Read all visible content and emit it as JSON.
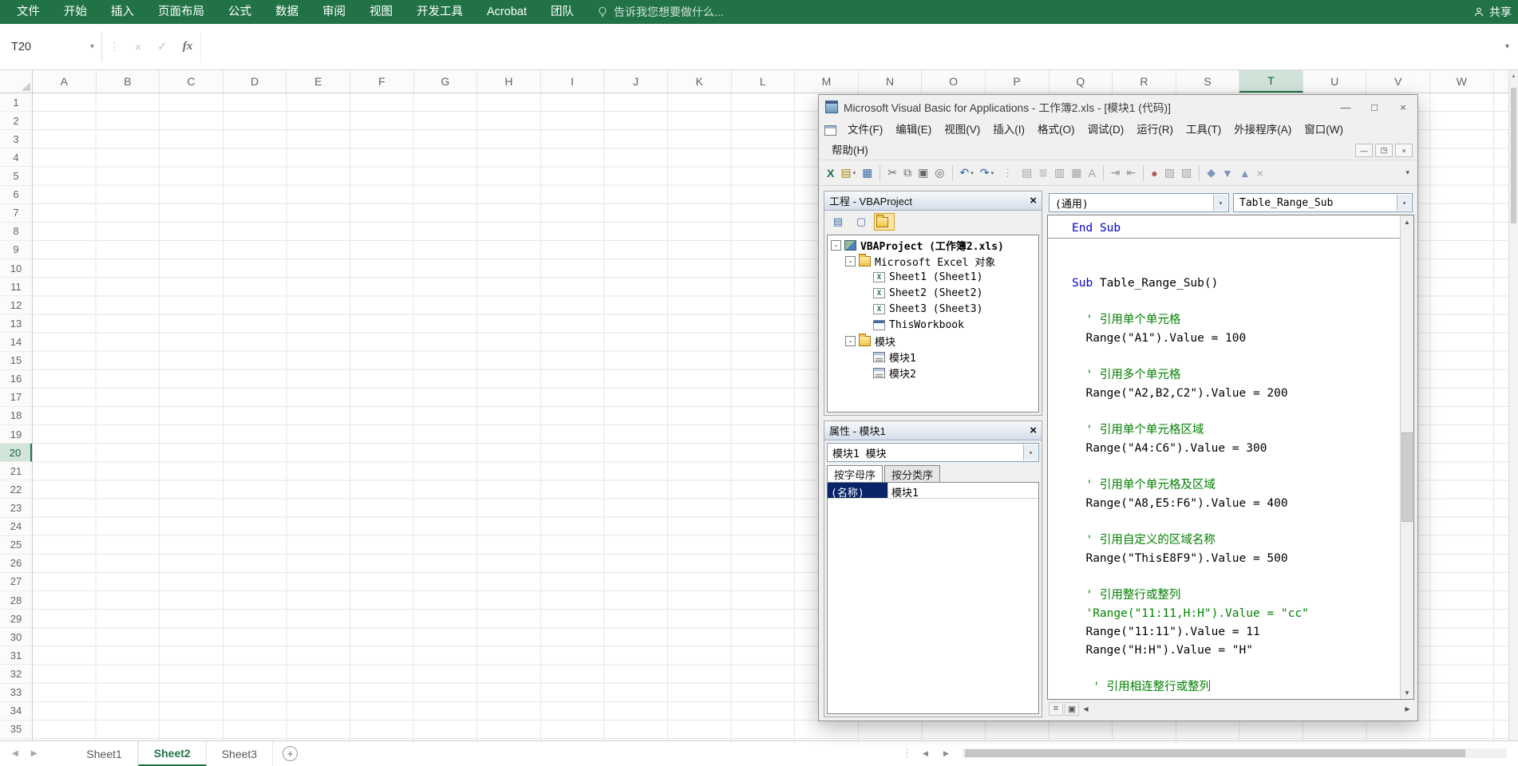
{
  "colors": {
    "excel_green": "#217346",
    "keyword_blue": "#0000d4",
    "comment_green": "#008000",
    "selection_blue": "#0a246a"
  },
  "icons": {
    "dropdown": "▾",
    "grip": "⋮",
    "cancel": "×",
    "confirm": "✓",
    "tri_up": "▲",
    "tri_down": "▼",
    "tri_left": "◀",
    "tri_right": "▶",
    "minimize": "—",
    "maximize": "□",
    "close": "×",
    "restore": "◳",
    "plus": "+",
    "collapse": "-",
    "chevron_down": "▾",
    "procedure_view": "≡",
    "module_view": "▣"
  },
  "excel": {
    "ribbon": {
      "tabs": [
        "文件",
        "开始",
        "插入",
        "页面布局",
        "公式",
        "数据",
        "审阅",
        "视图",
        "开发工具",
        "Acrobat",
        "团队"
      ],
      "tell_me": "告诉我您想要做什么...",
      "share": "共享"
    },
    "formula_bar": {
      "name_box": "T20",
      "fx": "fx",
      "value": ""
    },
    "columns": [
      "A",
      "B",
      "C",
      "D",
      "E",
      "F",
      "G",
      "H",
      "I",
      "J",
      "K",
      "L",
      "M",
      "N",
      "O",
      "P",
      "Q",
      "R",
      "S",
      "T",
      "U",
      "V",
      "W"
    ],
    "rows": [
      "1",
      "2",
      "3",
      "4",
      "5",
      "6",
      "7",
      "8",
      "9",
      "10",
      "11",
      "12",
      "13",
      "14",
      "15",
      "16",
      "17",
      "18",
      "19",
      "20",
      "21",
      "22",
      "23",
      "24",
      "25",
      "26",
      "27",
      "28",
      "29",
      "30",
      "31",
      "32",
      "33",
      "34",
      "35"
    ],
    "active_cell": {
      "column": "T",
      "row": "20"
    },
    "sheet_tabs": [
      "Sheet1",
      "Sheet2",
      "Sheet3"
    ],
    "active_sheet": "Sheet2"
  },
  "vba": {
    "title": "Microsoft Visual Basic for Applications - 工作簿2.xls - [模块1 (代码)]",
    "menus_row1": [
      "文件(F)",
      "编辑(E)",
      "视图(V)",
      "插入(I)",
      "格式(O)",
      "调试(D)",
      "运行(R)",
      "工具(T)",
      "外接程序(A)",
      "窗口(W)"
    ],
    "menus_row2": [
      "帮助(H)"
    ],
    "toolbar": [
      {
        "name": "view-excel-button",
        "glyph": "X",
        "color": "#1e7145",
        "bold": true
      },
      {
        "name": "insert-userform-button",
        "glyph": "▤",
        "color": "#a98500",
        "dropdown": true
      },
      {
        "name": "save-button",
        "glyph": "▦",
        "color": "#3a6ea5"
      },
      {
        "sep": true
      },
      {
        "name": "cut-button",
        "glyph": "✂",
        "color": "#666666"
      },
      {
        "name": "copy-button",
        "glyph": "⧉",
        "color": "#666666"
      },
      {
        "name": "paste-button",
        "glyph": "▣",
        "color": "#666666"
      },
      {
        "name": "find-button",
        "glyph": "◎",
        "color": "#666666"
      },
      {
        "sep": true
      },
      {
        "name": "undo-button",
        "glyph": "↶",
        "color": "#2f5f9e",
        "dropdown": true
      },
      {
        "name": "redo-button",
        "glyph": "↷",
        "color": "#2f5f9e",
        "dropdown": true
      },
      {
        "grip": true
      },
      {
        "name": "list-properties-button",
        "glyph": "▤",
        "color": "#a3a3a3",
        "disabled": true
      },
      {
        "name": "list-constants-button",
        "glyph": "≣",
        "color": "#a3a3a3",
        "disabled": true
      },
      {
        "name": "quick-info-button",
        "glyph": "▥",
        "color": "#a3a3a3",
        "disabled": true
      },
      {
        "name": "parameter-info-button",
        "glyph": "▦",
        "color": "#a3a3a3",
        "disabled": true
      },
      {
        "name": "complete-word-button",
        "glyph": "A",
        "color": "#a3a3a3",
        "disabled": true
      },
      {
        "sep": true
      },
      {
        "name": "indent-button",
        "glyph": "⇥",
        "color": "#8f8f8f",
        "disabled": true
      },
      {
        "name": "outdent-button",
        "glyph": "⇤",
        "color": "#8f8f8f",
        "disabled": true
      },
      {
        "sep": true
      },
      {
        "name": "toggle-breakpoint-button",
        "glyph": "●",
        "color": "#b05a5a",
        "disabled": true
      },
      {
        "name": "comment-block-button",
        "glyph": "▧",
        "color": "#a3a3a3",
        "disabled": true
      },
      {
        "name": "uncomment-block-button",
        "glyph": "▨",
        "color": "#a3a3a3",
        "disabled": true
      },
      {
        "sep": true
      },
      {
        "name": "toggle-bookmark-button",
        "glyph": "◆",
        "color": "#7e97b8",
        "disabled": true
      },
      {
        "name": "next-bookmark-button",
        "glyph": "▼",
        "color": "#7e97b8",
        "disabled": true
      },
      {
        "name": "previous-bookmark-button",
        "glyph": "▲",
        "color": "#7e97b8",
        "disabled": true
      },
      {
        "name": "clear-bookmarks-button",
        "glyph": "×",
        "color": "#a3a3a3",
        "disabled": true
      },
      {
        "overflow": true
      }
    ],
    "project": {
      "title": "工程 - VBAProject",
      "toolbar": [
        {
          "name": "view-code-button",
          "glyph": "▤",
          "color": "#3a6ea5"
        },
        {
          "name": "view-object-button",
          "glyph": "▢",
          "color": "#3a6ea5"
        },
        {
          "name": "toggle-folders-button",
          "glyph": "folder",
          "active": true
        }
      ],
      "tree": [
        {
          "label": "VBAProject (工作簿2.xls)",
          "level": 0,
          "icon": "project",
          "expander": true,
          "bold": true
        },
        {
          "label": "Microsoft Excel 对象",
          "level": 1,
          "icon": "folder",
          "expander": true
        },
        {
          "label": "Sheet1 (Sheet1)",
          "level": 2,
          "icon": "sheet"
        },
        {
          "label": "Sheet2 (Sheet2)",
          "level": 2,
          "icon": "sheet"
        },
        {
          "label": "Sheet3 (Sheet3)",
          "level": 2,
          "icon": "sheet"
        },
        {
          "label": "ThisWorkbook",
          "level": 2,
          "icon": "workbook"
        },
        {
          "label": "模块",
          "level": 1,
          "icon": "folder",
          "expander": true
        },
        {
          "label": "模块1",
          "level": 2,
          "icon": "module"
        },
        {
          "label": "模块2",
          "level": 2,
          "icon": "module"
        }
      ]
    },
    "properties": {
      "title": "属性 - 模块1",
      "object_selector": "模块1 模块",
      "tabs": [
        "按字母序",
        "按分类序"
      ],
      "grid": [
        {
          "name": "(名称)",
          "value": "模块1"
        }
      ]
    },
    "code": {
      "object_dropdown": "(通用)",
      "procedure_dropdown": "Table_Range_Sub",
      "lines": [
        {
          "segs": [
            {
              "t": "End Sub",
              "c": "k"
            }
          ],
          "divider": true
        },
        {
          "segs": []
        },
        {
          "segs": []
        },
        {
          "segs": [
            {
              "t": "Sub",
              "c": "k"
            },
            {
              "t": " Table_Range_Sub()",
              "c": "n"
            }
          ]
        },
        {
          "segs": []
        },
        {
          "segs": [
            {
              "t": "  ' 引用单个单元格",
              "c": "c"
            }
          ]
        },
        {
          "segs": [
            {
              "t": "  Range(\"A1\").Value = 100",
              "c": "n"
            }
          ]
        },
        {
          "segs": []
        },
        {
          "segs": [
            {
              "t": "  ' 引用多个单元格",
              "c": "c"
            }
          ]
        },
        {
          "segs": [
            {
              "t": "  Range(\"A2,B2,C2\").Value = 200",
              "c": "n"
            }
          ]
        },
        {
          "segs": []
        },
        {
          "segs": [
            {
              "t": "  ' 引用单个单元格区域",
              "c": "c"
            }
          ]
        },
        {
          "segs": [
            {
              "t": "  Range(\"A4:C6\").Value = 300",
              "c": "n"
            }
          ]
        },
        {
          "segs": []
        },
        {
          "segs": [
            {
              "t": "  ' 引用单个单元格及区域",
              "c": "c"
            }
          ]
        },
        {
          "segs": [
            {
              "t": "  Range(\"A8,E5:F6\").Value = 400",
              "c": "n"
            }
          ]
        },
        {
          "segs": []
        },
        {
          "segs": [
            {
              "t": "  ' 引用自定义的区域名称",
              "c": "c"
            }
          ]
        },
        {
          "segs": [
            {
              "t": "  Range(\"ThisE8F9\").Value = 500",
              "c": "n"
            }
          ]
        },
        {
          "segs": []
        },
        {
          "segs": [
            {
              "t": "  ' 引用整行或整列",
              "c": "c"
            }
          ]
        },
        {
          "segs": [
            {
              "t": "  'Range(\"11:11,H:H\").Value = \"cc\"",
              "c": "c"
            }
          ]
        },
        {
          "segs": [
            {
              "t": "  Range(\"11:11\").Value = 11",
              "c": "n"
            }
          ]
        },
        {
          "segs": [
            {
              "t": "  Range(\"H:H\").Value = \"H\"",
              "c": "n"
            }
          ]
        },
        {
          "segs": []
        },
        {
          "segs": [
            {
              "t": "   ' 引用相连整行或整列",
              "c": "c"
            }
          ]
        }
      ]
    }
  }
}
